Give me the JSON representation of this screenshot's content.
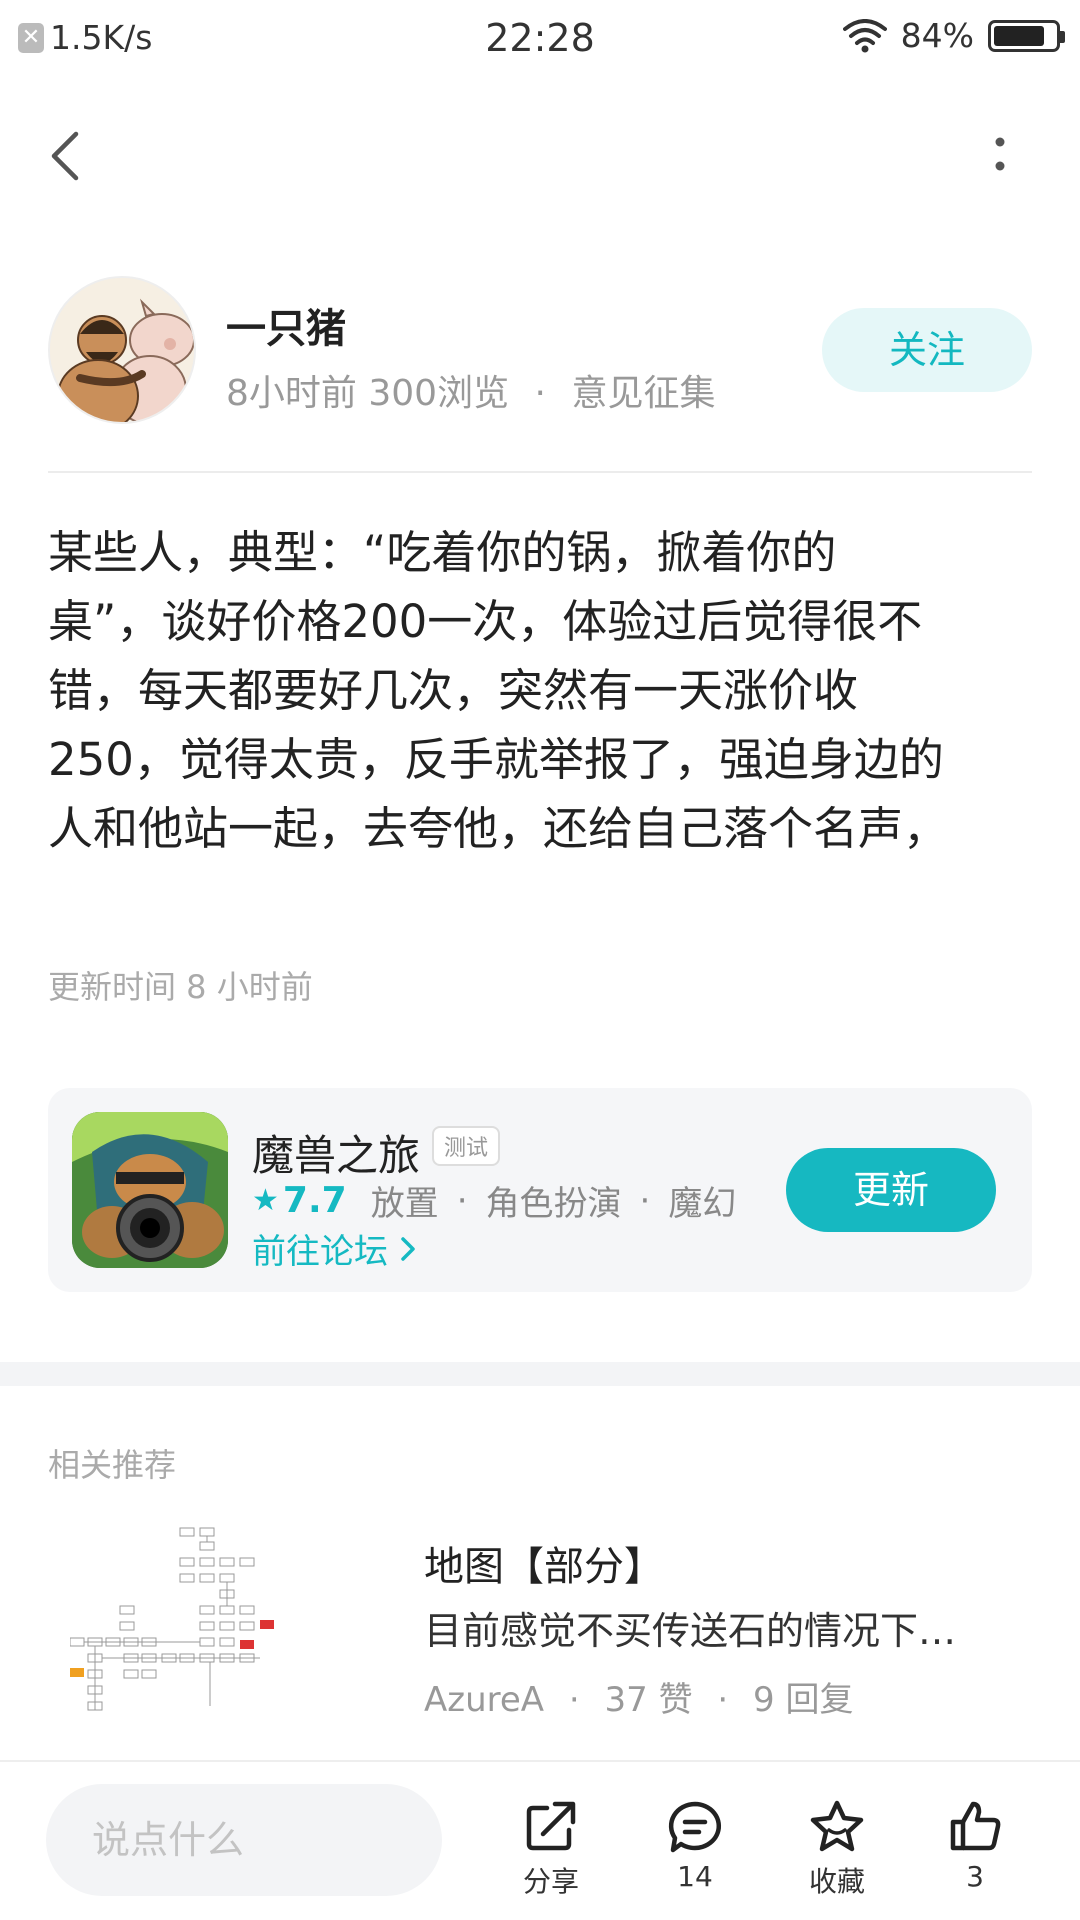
{
  "status_bar": {
    "speed": "1.5K/s",
    "time": "22:28",
    "battery": "84%",
    "battery_level": 0.84
  },
  "author": {
    "name": "一只猪",
    "time_ago": "8小时前",
    "views": "300浏览",
    "separator": "·",
    "category": "意见征集",
    "follow_label": "关注"
  },
  "post": {
    "lines": [
      "某些人，典型：“吃着你的锅，掀着你的",
      "桌”，谈好价格200一次，体验过后觉得很不",
      "错，每天都要好几次，突然有一天涨价收",
      "250，觉得太贵，反手就举报了，强迫身边的",
      "人和他站一起，去夸他，还给自己落个名声，"
    ],
    "update_time": "更新时间 8 小时前"
  },
  "game": {
    "name": "魔兽之旅",
    "tag": "测试",
    "score": "7.7",
    "genres": [
      "放置",
      "角色扮演",
      "魔幻"
    ],
    "separator": "·",
    "forum_link": "前往论坛",
    "update_label": "更新"
  },
  "recommend": {
    "section_title": "相关推荐",
    "items": [
      {
        "title": "地图【部分】",
        "snippet": "目前感觉不买传送石的情况下…",
        "author": "AzureA",
        "likes": "37 赞",
        "replies": "9 回复"
      }
    ]
  },
  "bottom_bar": {
    "comment_placeholder": "说点什么",
    "share_label": "分享",
    "comment_count": "14",
    "favorite_label": "收藏",
    "like_count": "3"
  },
  "colors": {
    "accent": "#16b8c1",
    "accent_light": "#e5f7f8"
  }
}
